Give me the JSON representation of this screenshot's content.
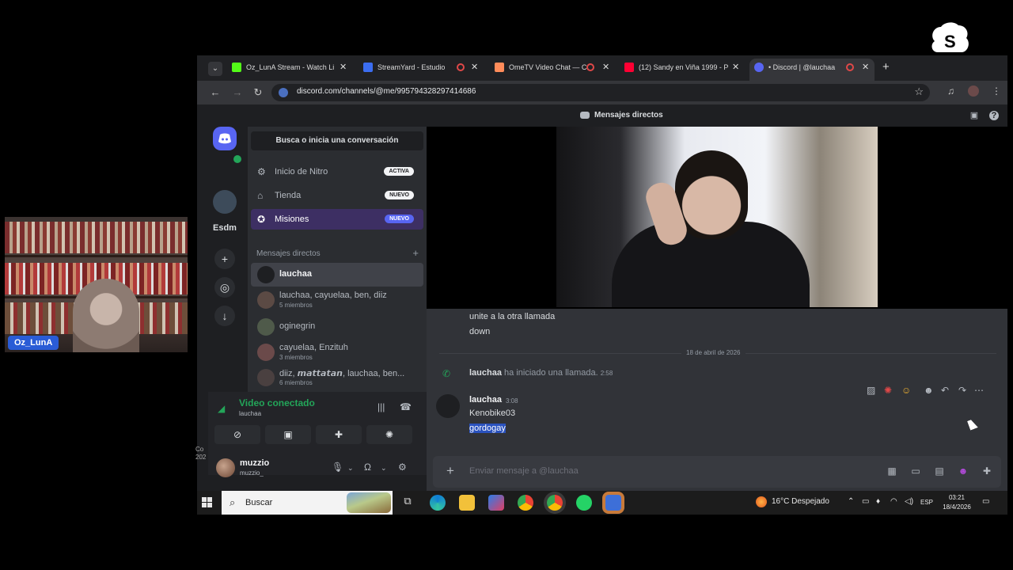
{
  "branding": {
    "name": "streamyard"
  },
  "presenter": {
    "name": "Oz_LunA"
  },
  "browser": {
    "tabs": [
      {
        "title": "Oz_LunA Stream - Watch Li",
        "color": "#53fc18"
      },
      {
        "title": "StreamYard - Estudio",
        "color": "#3b6df0"
      },
      {
        "title": "OmeTV Video Chat — C",
        "color": "#ff8c5a"
      },
      {
        "title": "(12) Sandy en Viña 1999 - P",
        "color": "#ff0033"
      },
      {
        "title": "• Discord | @lauchaa",
        "color": "#5865f2"
      }
    ],
    "url": "discord.com/channels/@me/995794328297414686"
  },
  "discord": {
    "title": "Mensajes directos",
    "rail": {
      "server_label": "Esdm"
    },
    "search_placeholder": "Busca o inicia una conversación",
    "nav": [
      {
        "label": "Inicio de Nitro",
        "badge": "ACTIVA",
        "icon": "nitro-icon"
      },
      {
        "label": "Tienda",
        "badge": "NUEVO",
        "icon": "shop-icon"
      },
      {
        "label": "Misiones",
        "badge": "NUEVO",
        "icon": "quests-icon"
      }
    ],
    "dm_header": "Mensajes directos",
    "conversations": [
      {
        "name": "lauchaa",
        "sub": ""
      },
      {
        "name": "lauchaa, cayuelaa, ben, diiz",
        "sub": "5 miembros"
      },
      {
        "name": "oginegrin",
        "sub": ""
      },
      {
        "name": "cayuelaa, Enzituh",
        "sub": "3 miembros"
      },
      {
        "name": "diiz, 𝙢𝙖𝙩𝙩𝙖𝙩𝙖𝙣, lauchaa, ben...",
        "sub": "6 miembros"
      }
    ],
    "voice": {
      "status": "Video conectado",
      "channel": "lauchaa"
    },
    "user": {
      "name": "muzzio",
      "tag": "muzzio_"
    },
    "messages": {
      "previous": [
        "unite a la otra llamada",
        "down"
      ],
      "date_divider": "18 de abril de 2026",
      "call": {
        "author": "lauchaa",
        "text": "ha iniciado una llamada.",
        "time": "2:58"
      },
      "last": {
        "author": "lauchaa",
        "time": "3:08",
        "lines": [
          "Kenobike03",
          "gordogay"
        ]
      }
    },
    "composer_placeholder": "Enviar mensaje a @lauchaa"
  },
  "taskbar": {
    "search": "Buscar",
    "weather": "16°C  Despejado",
    "lang": "ESP",
    "time": "03:21",
    "date": "18/4/2026"
  },
  "edge_text": {
    "line1": "Co",
    "line2": "202"
  }
}
